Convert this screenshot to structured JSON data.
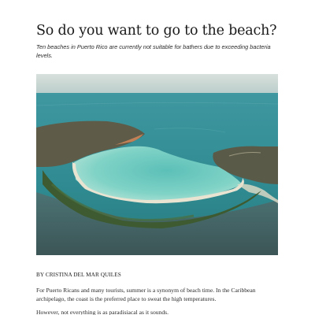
{
  "article": {
    "headline": "So do you want to go to the beach?",
    "subheadline": "Ten beaches in Puerto Rico are currently not suitable for bathers due to exceeding bacteria levels.",
    "byline": "BY CRISTINA DEL MAR QUILES",
    "paragraphs": [
      "For Puerto Ricans and many tourists, summer is a synonym of beach time. In the Caribbean archipelago, the coast is the preferred place to sweat the high temperatures.",
      "However, not everything is as paradisiacal as it sounds."
    ]
  },
  "photo": {
    "subject": "aerial-beach-lagoon",
    "colors": {
      "sky": "#cfd9d6",
      "sea": "#2f8f96",
      "lagoon": "#7ecfc4",
      "land": "#5b5a45",
      "mangrove": "#3d5a2f",
      "sand": "#e7e1cf",
      "shallows": "#4d6f70"
    }
  }
}
